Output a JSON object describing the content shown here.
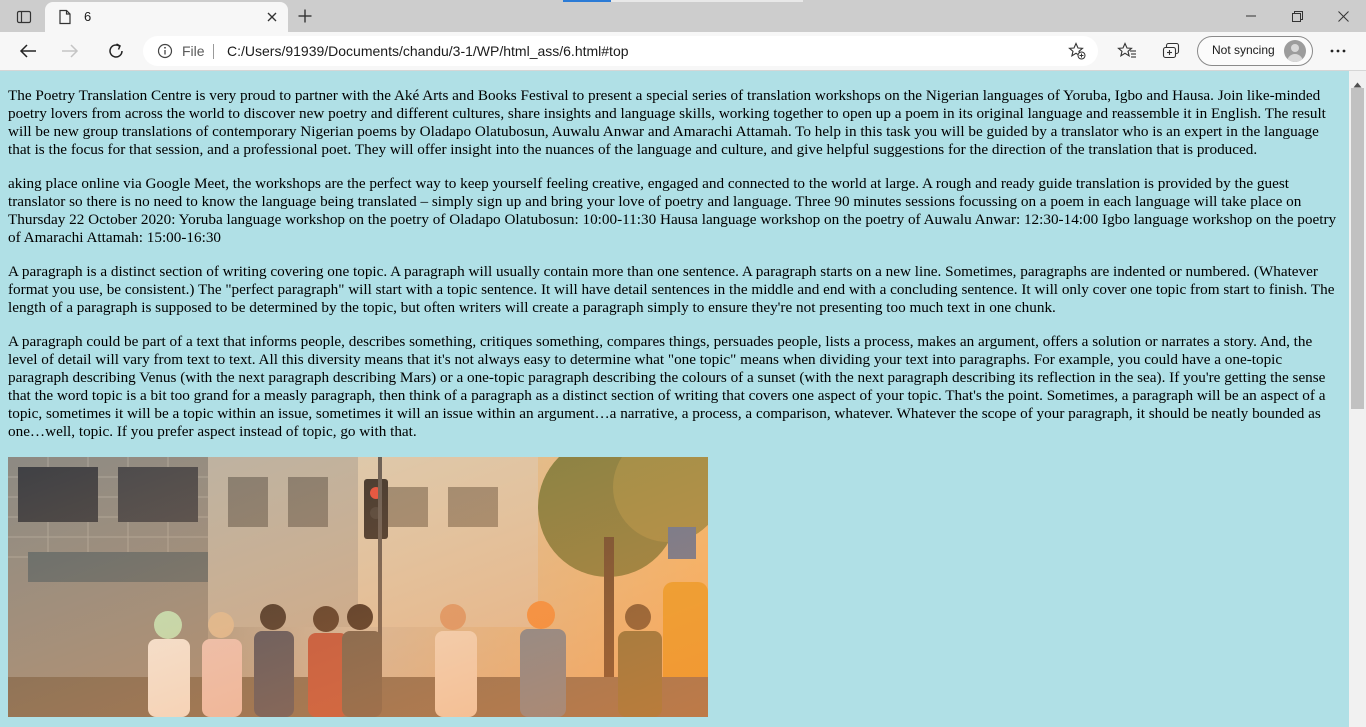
{
  "browser": {
    "tab_title": "6",
    "address_scheme_label": "File",
    "url": "C:/Users/91939/Documents/chandu/3-1/WP/html_ass/6.html#top",
    "sync_label": "Not syncing",
    "icons": {
      "tab_actions": "tab-actions-icon",
      "page": "page-icon",
      "close": "close-icon",
      "new_tab": "plus-icon",
      "back": "back-arrow-icon",
      "forward": "forward-arrow-icon",
      "reload": "reload-icon",
      "info": "info-icon",
      "add_favorite": "star-plus-icon",
      "favorites": "favorites-icon",
      "collections": "collections-icon",
      "profile": "profile-icon",
      "more": "more-icon"
    }
  },
  "page": {
    "background": "#b0e0e6",
    "paragraphs": [
      "The Poetry Translation Centre is very proud to partner with the Aké Arts and Books Festival to present a special series of translation workshops on the Nigerian languages of Yoruba, Igbo and Hausa. Join like-minded poetry lovers from across the world to discover new poetry and different cultures, share insights and language skills, working together to open up a poem in its original language and reassemble it in English. The result will be new group translations of contemporary Nigerian poems by Oladapo Olatubosun, Auwalu Anwar and Amarachi Attamah. To help in this task you will be guided by a translator who is an expert in the language that is the focus for that session, and a professional poet. They will offer insight into the nuances of the language and culture, and give helpful suggestions for the direction of the translation that is produced.",
      "aking place online via Google Meet, the workshops are the perfect way to keep yourself feeling creative, engaged and connected to the world at large. A rough and ready guide translation is provided by the guest translator so there is no need to know the language being translated – simply sign up and bring your love of poetry and language. Three 90 minutes sessions focussing on a poem in each language will take place on Thursday 22 October 2020: Yoruba language workshop on the poetry of Oladapo Olatubosun: 10:00-11:30 Hausa language workshop on the poetry of Auwalu Anwar: 12:30-14:00 Igbo language workshop on the poetry of Amarachi Attamah: 15:00-16:30",
      "A paragraph is a distinct section of writing covering one topic. A paragraph will usually contain more than one sentence. A paragraph starts on a new line. Sometimes, paragraphs are indented or numbered. (Whatever format you use, be consistent.) The \"perfect paragraph\" will start with a topic sentence. It will have detail sentences in the middle and end with a concluding sentence. It will only cover one topic from start to finish. The length of a paragraph is supposed to be determined by the topic, but often writers will create a paragraph simply to ensure they're not presenting too much text in one chunk.",
      "A paragraph could be part of a text that informs people, describes something, critiques something, compares things, persuades people, lists a process, makes an argument, offers a solution or narrates a story. And, the level of detail will vary from text to text. All this diversity means that it's not always easy to determine what \"one topic\" means when dividing your text into paragraphs. For example, you could have a one-topic paragraph describing Venus (with the next paragraph describing Mars) or a one-topic paragraph describing the colours of a sunset (with the next paragraph describing its reflection in the sea). If you're getting the sense that the word topic is a bit too grand for a measly paragraph, then think of a paragraph as a distinct section of writing that covers one aspect of your topic. That's the point. Sometimes, a paragraph will be an aspect of a topic, sometimes it will be a topic within an issue, sometimes it will an issue within an argument…a narrative, a process, a comparison, whatever. Whatever the scope of your paragraph, it should be neatly bounded as one…well, topic. If you prefer aspect instead of topic, go with that."
    ]
  }
}
